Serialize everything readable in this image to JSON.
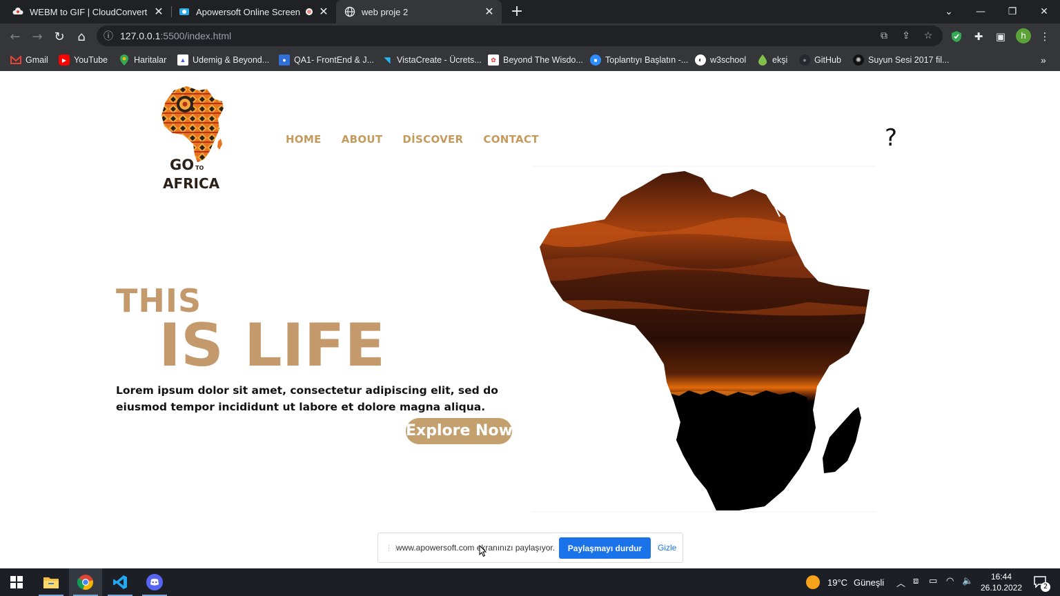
{
  "browser": {
    "tabs": [
      {
        "title": "WEBM to GIF | CloudConvert",
        "icon": "cloudconvert-icon"
      },
      {
        "title": "Apowersoft Online Screen Re",
        "icon": "apowersoft-icon"
      },
      {
        "title": "web proje 2",
        "icon": "globe-icon"
      }
    ],
    "url_host": "127.0.0.1",
    "url_path": ":5500/index.html",
    "bookmarks": [
      "Gmail",
      "YouTube",
      "Haritalar",
      "Udemig & Beyond...",
      "QA1- FrontEnd & J...",
      "VistaCreate - Ücrets...",
      "Beyond The Wisdo...",
      "Toplantıyı Başlatın -...",
      "w3school",
      "ekşi",
      "GitHub",
      "Suyun Sesi 2017 fil..."
    ]
  },
  "page": {
    "logo": {
      "line1": "GO",
      "line1_small": "TO",
      "line2": "AFRICA"
    },
    "nav": [
      "HOME",
      "ABOUT",
      "DİSCOVER",
      "CONTACT"
    ],
    "help_symbol": "?",
    "title_line1": "THIS",
    "title_line2": "IS LIFE",
    "description": "Lorem ipsum dolor sit amet, consectetur adipiscing elit, sed do eiusmod tempor incididunt ut labore et dolore magna aliqua.",
    "cta": "Explore Now"
  },
  "share_bar": {
    "text": "www.apowersoft.com ekranınızı paylaşıyor.",
    "stop_button": "Paylaşmayı durdur",
    "hide_link": "Gizle"
  },
  "taskbar": {
    "weather": {
      "temp": "19°C",
      "desc": "Güneşli"
    },
    "time": "16:44",
    "date": "26.10.2022",
    "notifications": "2"
  },
  "colors": {
    "accent": "#c49a6c",
    "chrome_dark": "#202124",
    "chrome": "#35363a",
    "link_blue": "#1a73e8"
  }
}
